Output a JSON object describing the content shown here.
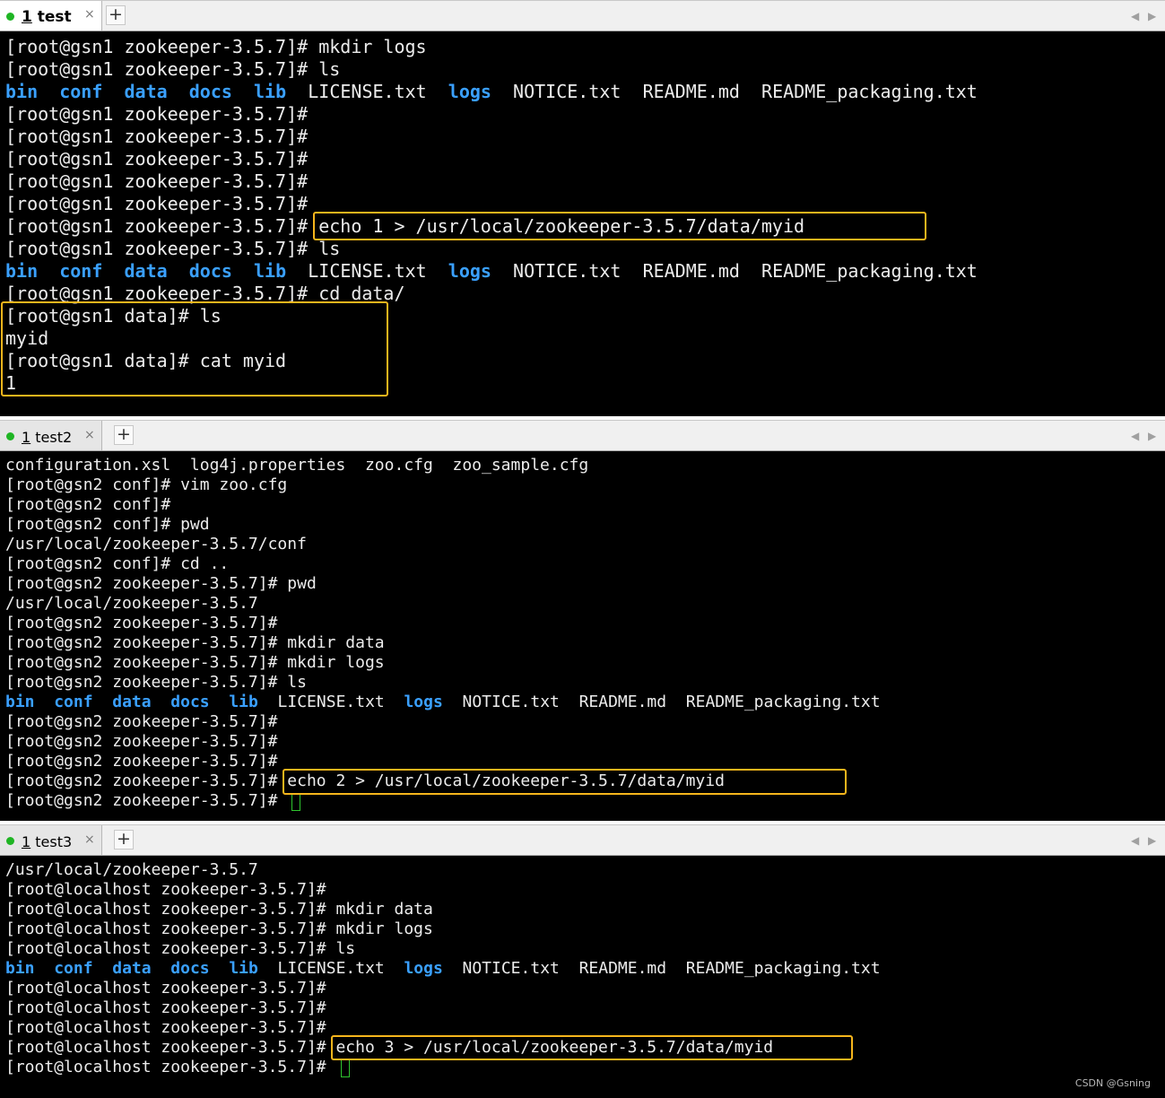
{
  "colors": {
    "highlight": "#f5b51c",
    "directory": "#3aa0ff",
    "text": "#ececec",
    "background": "#000000",
    "tab_dot": "#1fb524"
  },
  "pane1": {
    "tab": {
      "number": "1",
      "name": "test",
      "close": "×"
    },
    "new_tab": "+",
    "lines": [
      "[root@gsn1 zookeeper-3.5.7]# mkdir logs",
      "[root@gsn1 zookeeper-3.5.7]# ls",
      "",
      "[root@gsn1 zookeeper-3.5.7]#",
      "[root@gsn1 zookeeper-3.5.7]#",
      "[root@gsn1 zookeeper-3.5.7]#",
      "[root@gsn1 zookeeper-3.5.7]#",
      "[root@gsn1 zookeeper-3.5.7]#",
      "[root@gsn1 zookeeper-3.5.7]# echo 1 > /usr/local/zookeeper-3.5.7/data/myid",
      "[root@gsn1 zookeeper-3.5.7]# ls",
      "",
      "[root@gsn1 zookeeper-3.5.7]# cd data/",
      "[root@gsn1 data]# ls",
      "myid",
      "[root@gsn1 data]# cat myid",
      "1"
    ],
    "ls_output": {
      "dirs_a": [
        "bin",
        "conf",
        "data",
        "docs",
        "lib"
      ],
      "file_a": "LICENSE.txt",
      "dir_b": "logs",
      "files_b": [
        "NOTICE.txt",
        "README.md",
        "README_packaging.txt"
      ]
    }
  },
  "pane2": {
    "tab": {
      "number": "1",
      "name": "test2",
      "close": "×"
    },
    "new_tab": "+",
    "lines": [
      "configuration.xsl  log4j.properties  zoo.cfg  zoo_sample.cfg",
      "[root@gsn2 conf]# vim zoo.cfg",
      "[root@gsn2 conf]#",
      "[root@gsn2 conf]# pwd",
      "/usr/local/zookeeper-3.5.7/conf",
      "[root@gsn2 conf]# cd ..",
      "[root@gsn2 zookeeper-3.5.7]# pwd",
      "/usr/local/zookeeper-3.5.7",
      "[root@gsn2 zookeeper-3.5.7]#",
      "[root@gsn2 zookeeper-3.5.7]# mkdir data",
      "[root@gsn2 zookeeper-3.5.7]# mkdir logs",
      "[root@gsn2 zookeeper-3.5.7]# ls",
      "",
      "[root@gsn2 zookeeper-3.5.7]#",
      "[root@gsn2 zookeeper-3.5.7]#",
      "[root@gsn2 zookeeper-3.5.7]#",
      "[root@gsn2 zookeeper-3.5.7]# echo 2 > /usr/local/zookeeper-3.5.7/data/myid",
      "[root@gsn2 zookeeper-3.5.7]# "
    ],
    "ls_output": {
      "dirs_a": [
        "bin",
        "conf",
        "data",
        "docs",
        "lib"
      ],
      "file_a": "LICENSE.txt",
      "dir_b": "logs",
      "files_b": [
        "NOTICE.txt",
        "README.md",
        "README_packaging.txt"
      ]
    }
  },
  "pane3": {
    "tab": {
      "number": "1",
      "name": "test3",
      "close": "×"
    },
    "new_tab": "+",
    "lines": [
      "/usr/local/zookeeper-3.5.7",
      "[root@localhost zookeeper-3.5.7]#",
      "[root@localhost zookeeper-3.5.7]# mkdir data",
      "[root@localhost zookeeper-3.5.7]# mkdir logs",
      "[root@localhost zookeeper-3.5.7]# ls",
      "",
      "[root@localhost zookeeper-3.5.7]#",
      "[root@localhost zookeeper-3.5.7]#",
      "[root@localhost zookeeper-3.5.7]#",
      "[root@localhost zookeeper-3.5.7]# echo 3 > /usr/local/zookeeper-3.5.7/data/myid",
      "[root@localhost zookeeper-3.5.7]# "
    ],
    "ls_output": {
      "dirs_a": [
        "bin",
        "conf",
        "data",
        "docs",
        "lib"
      ],
      "file_a": "LICENSE.txt",
      "dir_b": "logs",
      "files_b": [
        "NOTICE.txt",
        "README.md",
        "README_packaging.txt"
      ]
    }
  },
  "watermark": "CSDN @Gsning"
}
